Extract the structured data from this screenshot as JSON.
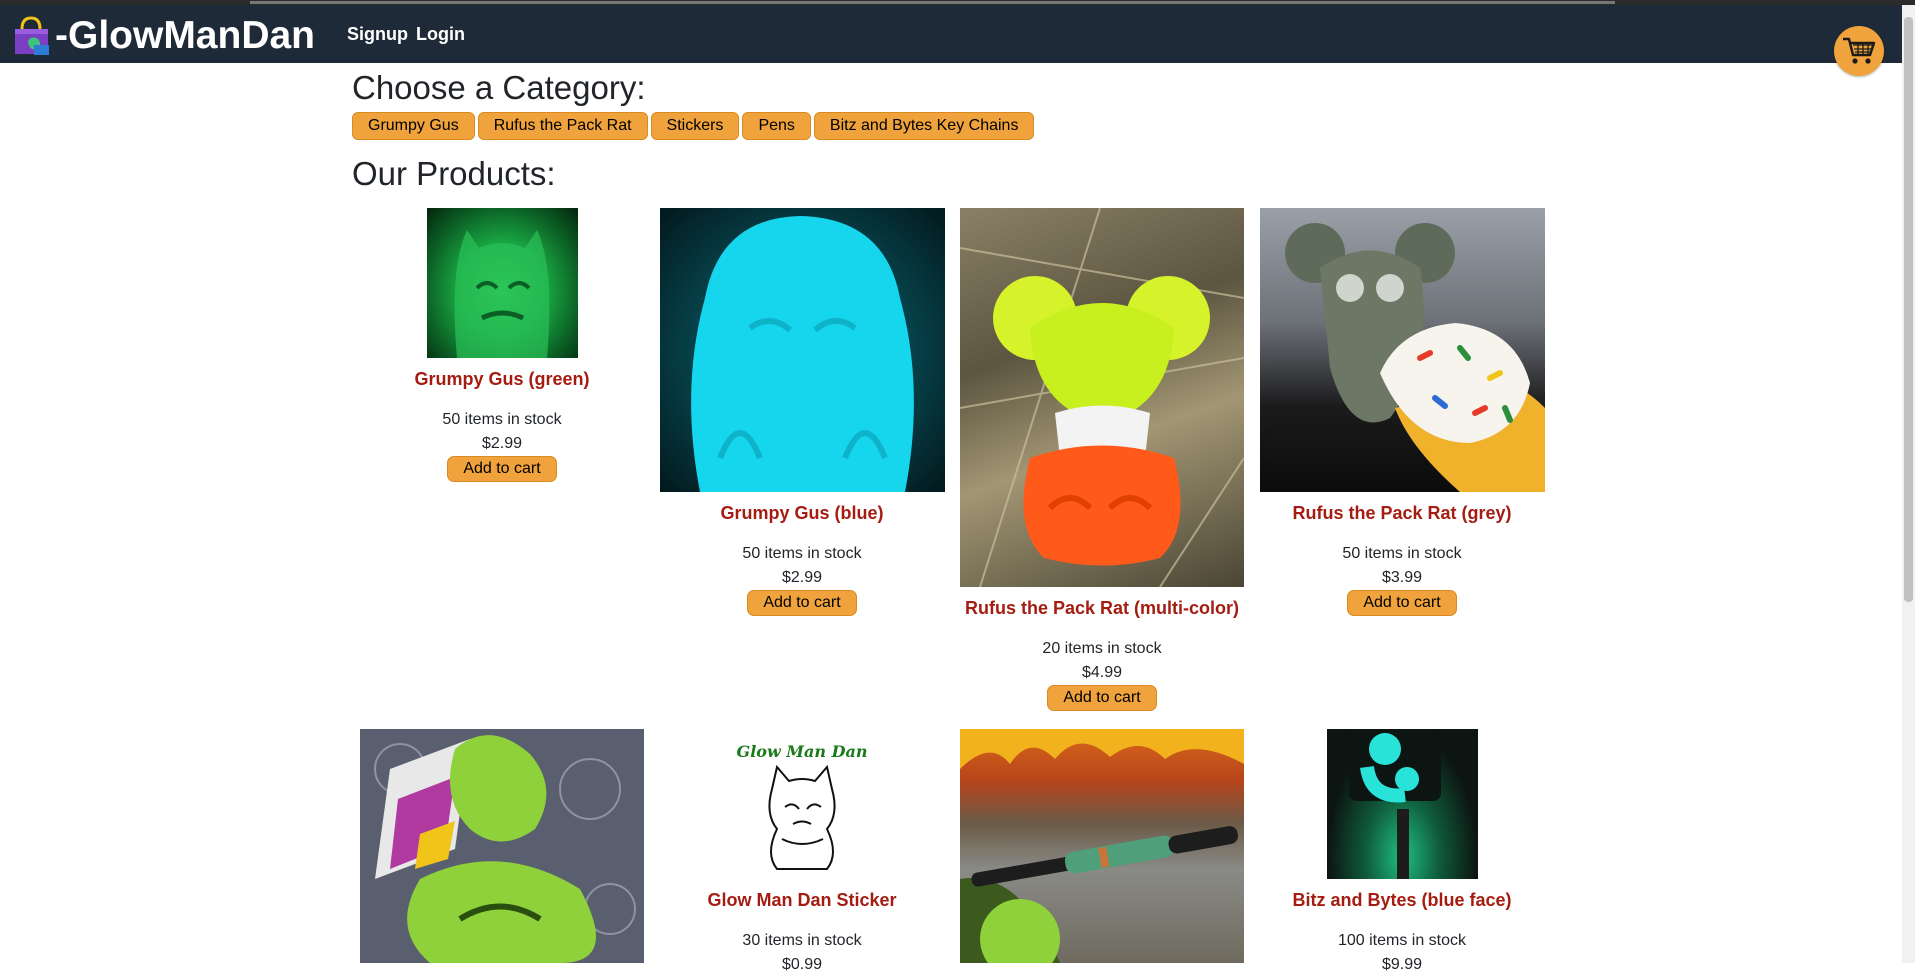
{
  "brand": {
    "name": "-GlowManDan"
  },
  "nav": {
    "signup": "Signup",
    "login": "Login"
  },
  "cart_icon": "shopping-cart-icon",
  "category_heading": "Choose a Category:",
  "categories": [
    "Grumpy Gus",
    "Rufus the Pack Rat",
    "Stickers",
    "Pens",
    "Bitz and Bytes Key Chains"
  ],
  "products_heading": "Our Products:",
  "add_label": "Add to cart",
  "products": [
    {
      "name": "Grumpy Gus (green)",
      "stock": "50 items in stock",
      "price": "$2.99"
    },
    {
      "name": "Grumpy Gus (blue)",
      "stock": "50 items in stock",
      "price": "$2.99"
    },
    {
      "name": "Rufus the Pack Rat (multi-color)",
      "stock": "20 items in stock",
      "price": "$4.99"
    },
    {
      "name": "Rufus the Pack Rat (grey)",
      "stock": "50 items in stock",
      "price": "$3.99"
    },
    {
      "name": "Glow Man Dan Sticker",
      "stock": "30 items in stock",
      "price": "$0.99"
    },
    {
      "name": "Bitz and Bytes (blue face)",
      "stock": "100 items in stock",
      "price": "$9.99"
    }
  ],
  "sticker_text": "Glow Man Dan",
  "colors": {
    "navbar": "#1f2a38",
    "accent": "#f0a33c",
    "product_name": "#a51d12"
  }
}
